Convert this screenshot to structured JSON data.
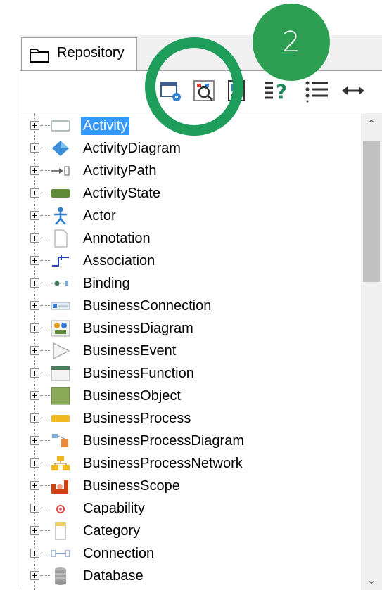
{
  "tab": {
    "label": "Repository",
    "icon": "folder-icon"
  },
  "callout": {
    "number": "2"
  },
  "toolbar": [
    {
      "name": "settings-view-icon"
    },
    {
      "name": "search-diagram-icon"
    },
    {
      "name": "document-icon"
    },
    {
      "name": "help-list-icon"
    },
    {
      "name": "list-icon"
    },
    {
      "name": "expand-horizontal-icon"
    }
  ],
  "tree": {
    "items": [
      {
        "label": "Activity",
        "icon": "activity-icon",
        "selected": true
      },
      {
        "label": "ActivityDiagram",
        "icon": "activity-diagram-icon"
      },
      {
        "label": "ActivityPath",
        "icon": "activity-path-icon"
      },
      {
        "label": "ActivityState",
        "icon": "activity-state-icon"
      },
      {
        "label": "Actor",
        "icon": "actor-icon"
      },
      {
        "label": "Annotation",
        "icon": "annotation-icon"
      },
      {
        "label": "Association",
        "icon": "association-icon"
      },
      {
        "label": "Binding",
        "icon": "binding-icon"
      },
      {
        "label": "BusinessConnection",
        "icon": "business-connection-icon"
      },
      {
        "label": "BusinessDiagram",
        "icon": "business-diagram-icon"
      },
      {
        "label": "BusinessEvent",
        "icon": "business-event-icon"
      },
      {
        "label": "BusinessFunction",
        "icon": "business-function-icon"
      },
      {
        "label": "BusinessObject",
        "icon": "business-object-icon"
      },
      {
        "label": "BusinessProcess",
        "icon": "business-process-icon"
      },
      {
        "label": "BusinessProcessDiagram",
        "icon": "business-process-diagram-icon"
      },
      {
        "label": "BusinessProcessNetwork",
        "icon": "business-process-network-icon"
      },
      {
        "label": "BusinessScope",
        "icon": "business-scope-icon"
      },
      {
        "label": "Capability",
        "icon": "capability-icon"
      },
      {
        "label": "Category",
        "icon": "category-icon"
      },
      {
        "label": "Connection",
        "icon": "connection-icon"
      },
      {
        "label": "Database",
        "icon": "database-icon"
      }
    ]
  },
  "colors": {
    "accent": "#1e9d5b",
    "selection": "#3399ff"
  }
}
